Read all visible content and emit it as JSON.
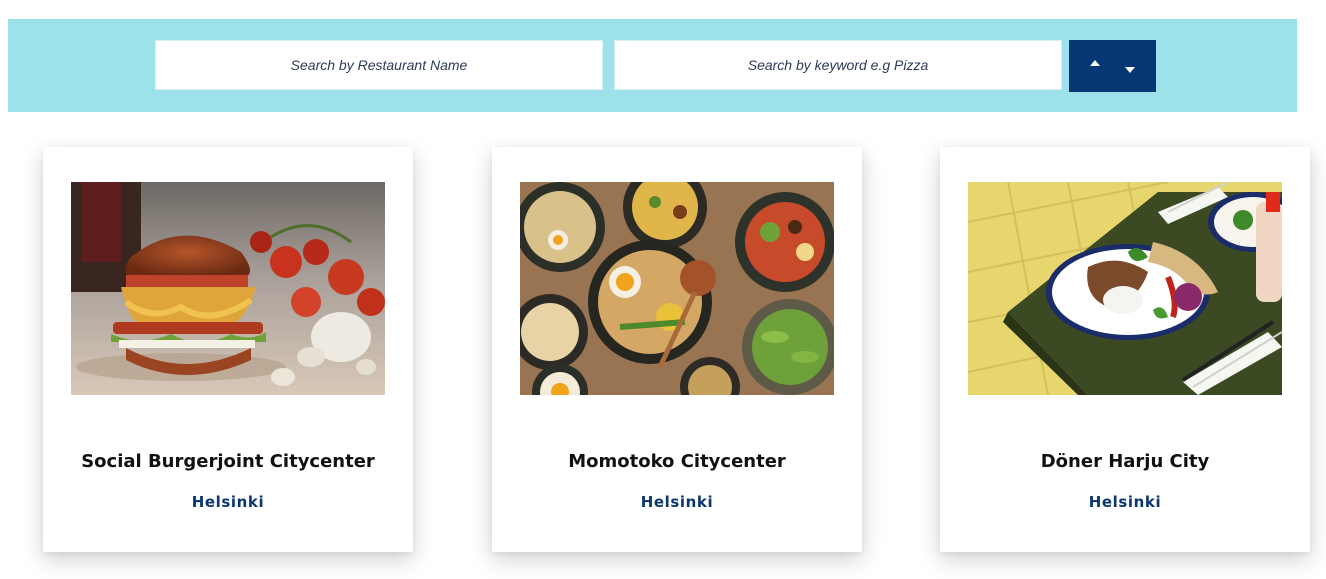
{
  "search": {
    "name_placeholder": "Search by Restaurant Name",
    "keyword_placeholder": "Search by keyword e.g Pizza"
  },
  "sort": {
    "up_icon": "caret-up-icon",
    "down_icon": "caret-down-icon"
  },
  "colors": {
    "search_bar_bg": "#9de2ea",
    "sort_bg": "#043773",
    "city_text": "#0a3770"
  },
  "restaurants": [
    {
      "name": "Social Burgerjoint Citycenter",
      "city": "Helsinki",
      "image": "burger-photo"
    },
    {
      "name": "Momotoko Citycenter",
      "city": "Helsinki",
      "image": "ramen-bowls-photo"
    },
    {
      "name": "Döner Harju City",
      "city": "Helsinki",
      "image": "doner-plate-photo"
    }
  ]
}
